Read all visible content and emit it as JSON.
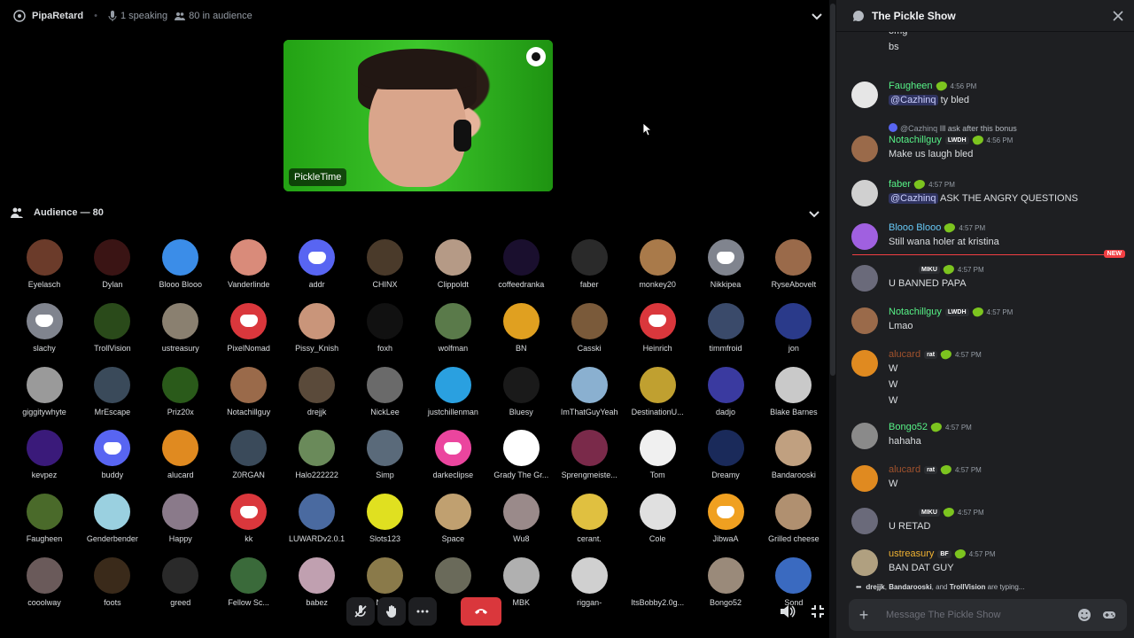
{
  "stage": {
    "title": "PipaRetard",
    "speaking": "1 speaking",
    "audience_count": "80 in audience",
    "speaker": {
      "name": "PickleTime"
    },
    "audience_header": "Audience — 80"
  },
  "audience": [
    {
      "name": "Eyelasch",
      "color": "#6b3b2a"
    },
    {
      "name": "Dylan",
      "color": "#3a1414"
    },
    {
      "name": "Blooo Blooo",
      "color": "#3b8de8"
    },
    {
      "name": "Vanderlinde",
      "color": "#d98b7a"
    },
    {
      "name": "addr",
      "color": "#5865f2",
      "discord": true
    },
    {
      "name": "CHINX",
      "color": "#4a3a2a"
    },
    {
      "name": "Clippoldt",
      "color": "#b59a86"
    },
    {
      "name": "coffeedranka",
      "color": "#1a0f2e"
    },
    {
      "name": "faber",
      "color": "#2a2a2a"
    },
    {
      "name": "monkey20",
      "color": "#a97a4a"
    },
    {
      "name": "Nikkipea",
      "color": "#80848e",
      "discord": true
    },
    {
      "name": "RyseAbovelt",
      "color": "#9a6a4a"
    },
    {
      "name": "slachy",
      "color": "#80848e",
      "discord": true
    },
    {
      "name": "TrollVision",
      "color": "#2a4a1a"
    },
    {
      "name": "ustreasury",
      "color": "#8a8070"
    },
    {
      "name": "PixelNomad",
      "color": "#da373c",
      "discord": true
    },
    {
      "name": "Pissy_Knish",
      "color": "#c9957a"
    },
    {
      "name": "foxh",
      "color": "#111111"
    },
    {
      "name": "wolfman",
      "color": "#5a7a4a"
    },
    {
      "name": "BN",
      "color": "#e0a020"
    },
    {
      "name": "Casski",
      "color": "#7a5a3a"
    },
    {
      "name": "Heinrich",
      "color": "#da373c",
      "discord": true
    },
    {
      "name": "timmfroid",
      "color": "#3a4a6a"
    },
    {
      "name": "jon",
      "color": "#2a3a8a"
    },
    {
      "name": "giggitywhyte",
      "color": "#9a9a9a"
    },
    {
      "name": "MrEscape",
      "color": "#3a4a5a"
    },
    {
      "name": "Priz20x",
      "color": "#2a5a1a"
    },
    {
      "name": "Notachillguy",
      "color": "#9a6a4a"
    },
    {
      "name": "drejjk",
      "color": "#5a4a3a"
    },
    {
      "name": "NickLee",
      "color": "#6a6a6a"
    },
    {
      "name": "justchillenman",
      "color": "#2aa0e0"
    },
    {
      "name": "Bluesy",
      "color": "#1a1a1a"
    },
    {
      "name": "ImThatGuyYeah",
      "color": "#8ab0d0"
    },
    {
      "name": "DestinationU...",
      "color": "#c0a030"
    },
    {
      "name": "dadjo",
      "color": "#3a3aa0"
    },
    {
      "name": "Blake Barnes",
      "color": "#c9c9c9"
    },
    {
      "name": "kevpez",
      "color": "#3a1a7a"
    },
    {
      "name": "buddy",
      "color": "#5865f2",
      "discord": true
    },
    {
      "name": "alucard",
      "color": "#e08a20"
    },
    {
      "name": "Z0RGAN",
      "color": "#3a4a5a"
    },
    {
      "name": "Halo222222",
      "color": "#6a8a5a"
    },
    {
      "name": "Simp",
      "color": "#5a6a7a"
    },
    {
      "name": "darkeclipse",
      "color": "#eb459e",
      "discord": true
    },
    {
      "name": "Grady The Gr...",
      "color": "#ffffff"
    },
    {
      "name": "Sprengmeiste...",
      "color": "#7a2a4a"
    },
    {
      "name": "Tom",
      "color": "#f0f0f0"
    },
    {
      "name": "Dreamy",
      "color": "#1a2a5a"
    },
    {
      "name": "Bandarooski",
      "color": "#c0a080"
    },
    {
      "name": "Faugheen",
      "color": "#4a6a2a"
    },
    {
      "name": "Genderbender",
      "color": "#9ad0e0"
    },
    {
      "name": "Happy",
      "color": "#8a7a8a"
    },
    {
      "name": "kk",
      "color": "#da373c",
      "discord": true
    },
    {
      "name": "LUWARDv2.0.1",
      "color": "#4a6aa0"
    },
    {
      "name": "Slots123",
      "color": "#e0e020"
    },
    {
      "name": "Space",
      "color": "#c0a070"
    },
    {
      "name": "Wu8",
      "color": "#9a8a8a"
    },
    {
      "name": "cerant.",
      "color": "#e0c040"
    },
    {
      "name": "Cole",
      "color": "#e0e0e0"
    },
    {
      "name": "JibwaA",
      "color": "#f0a020",
      "discord": true
    },
    {
      "name": "Grilled cheese",
      "color": "#b09070"
    },
    {
      "name": "cooolway",
      "color": "#6a5a5a"
    },
    {
      "name": "foots",
      "color": "#3a2a1a"
    },
    {
      "name": "greed",
      "color": "#2a2a2a"
    },
    {
      "name": "Fellow Sc...",
      "color": "#3a6a3a"
    },
    {
      "name": "babez",
      "color": "#c0a0b0"
    },
    {
      "name": "Me...",
      "color": "#8a7a4a"
    },
    {
      "name": "",
      "color": "#6a6a5a"
    },
    {
      "name": "MBK",
      "color": "#b0b0b0"
    },
    {
      "name": "riggan-",
      "color": "#d0d0d0"
    },
    {
      "name": "ItsBobby2.0g...",
      "color": "#000000"
    },
    {
      "name": "Bongo52",
      "color": "#9a8a7a"
    },
    {
      "name": "Sond",
      "color": "#3a6ac0"
    }
  ],
  "controls": [
    "mute-toggle",
    "raise-hand",
    "more"
  ],
  "chat": {
    "channel": "The Pickle Show",
    "messages": [
      {
        "lines": [
          "omg",
          "bs"
        ]
      },
      {
        "author": "Faugheen",
        "author_color": "#57f287",
        "time": "4:56 PM",
        "mention": "@Cazhinq",
        "text": " ty bled"
      },
      {
        "reply_author": "@Cazhinq",
        "reply_text": "Ill ask after this bonus",
        "author": "Notachillguy",
        "author_color": "#57f287",
        "tag": "LWDH",
        "time": "4:56 PM",
        "text": "Make us laugh bled"
      },
      {
        "author": "faber",
        "author_color": "#57f287",
        "time": "4:57 PM",
        "mention": "@Cazhinq",
        "text": " ASK THE ANGRY QUESTIONS"
      },
      {
        "author": "Blooo Blooo",
        "author_color": "#67c8f5",
        "time": "4:57 PM",
        "text": "Still wana holer at kristina"
      },
      {
        "author": "",
        "tag": "MIKU",
        "time": "4:57 PM",
        "text": "U BANNED PAPA"
      },
      {
        "author": "Notachillguy",
        "author_color": "#57f287",
        "tag": "LWDH",
        "time": "4:57 PM",
        "text": "Lmao"
      },
      {
        "author": "alucard",
        "author_color": "#a0522d",
        "tag": "rat",
        "time": "4:57 PM",
        "lines": [
          "W",
          "W",
          "W"
        ]
      },
      {
        "author": "Bongo52",
        "author_color": "#57f287",
        "time": "4:57 PM",
        "text": "hahaha"
      },
      {
        "author": "alucard",
        "author_color": "#a0522d",
        "tag": "rat",
        "time": "4:57 PM",
        "text": "W"
      },
      {
        "author": "",
        "tag": "MIKU",
        "time": "4:57 PM",
        "text": "U RETAD"
      },
      {
        "author": "ustreasury",
        "author_color": "#f0b232",
        "tag": "BF",
        "time": "4:57 PM",
        "text": "BAN DAT GUY"
      }
    ],
    "new_label": "NEW",
    "typing": {
      "names": [
        "drejjk",
        "Bandarooski",
        "TrollVision"
      ],
      "suffix": "are typing..."
    },
    "composer_placeholder": "Message The Pickle Show"
  }
}
